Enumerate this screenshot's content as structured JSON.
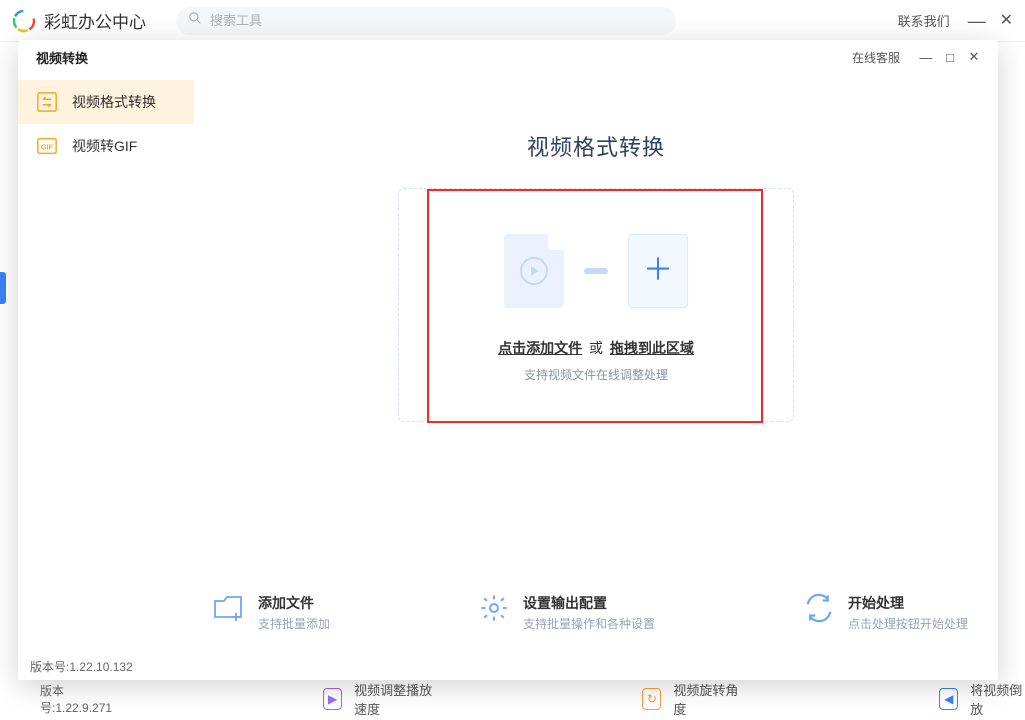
{
  "bg": {
    "title": "彩虹办公中心",
    "search_placeholder": "搜索工具",
    "contact": "联系我们",
    "version_label": "版本号:1.22.9.271",
    "features": [
      "视频调整播放速度",
      "视频旋转角度",
      "将视频倒放"
    ]
  },
  "dialog": {
    "title": "视频转换",
    "service": "在线客服",
    "version_label": "版本号:1.22.10.132"
  },
  "sidebar": {
    "items": [
      {
        "label": "视频格式转换"
      },
      {
        "label": "视频转GIF"
      }
    ]
  },
  "main": {
    "heading": "视频格式转换",
    "drop_click": "点击添加文件",
    "drop_or": "或",
    "drop_drag": "拖拽到此区域",
    "drop_sub": "支持视频文件在线调整处理"
  },
  "steps": [
    {
      "title": "添加文件",
      "sub": "支持批量添加"
    },
    {
      "title": "设置输出配置",
      "sub": "支持批量操作和各种设置"
    },
    {
      "title": "开始处理",
      "sub": "点击处理按钮开始处理"
    }
  ]
}
